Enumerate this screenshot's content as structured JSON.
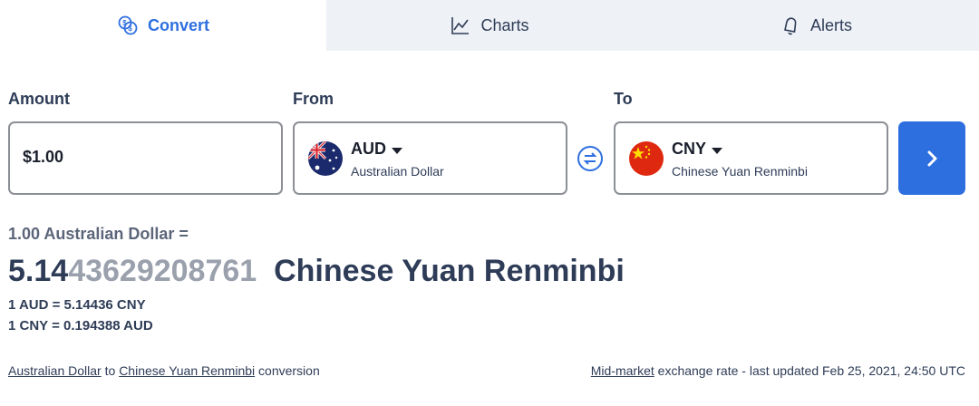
{
  "tabs": [
    {
      "label": "Convert",
      "icon": "coins-icon",
      "active": true
    },
    {
      "label": "Charts",
      "icon": "chart-line-icon",
      "active": false
    },
    {
      "label": "Alerts",
      "icon": "bell-icon",
      "active": false
    }
  ],
  "form": {
    "amount_label": "Amount",
    "amount_value": "$1.00",
    "from_label": "From",
    "to_label": "To",
    "from": {
      "code": "AUD",
      "name": "Australian Dollar",
      "flag": "australia-flag-icon"
    },
    "to": {
      "code": "CNY",
      "name": "Chinese Yuan Renminbi",
      "flag": "china-flag-icon"
    },
    "swap_icon": "swap-icon",
    "submit_icon": "chevron-right-icon"
  },
  "result": {
    "from_text": "1.00 Australian Dollar =",
    "value_main": "5.14",
    "value_rest": "43629208761",
    "to_name": "Chinese Yuan Renminbi",
    "rate_forward": "1 AUD = 5.14436 CNY",
    "rate_reverse": "1 CNY = 0.194388 AUD"
  },
  "footer": {
    "from_link": "Australian Dollar",
    "to_word": "to",
    "to_link": "Chinese Yuan Renminbi",
    "conversion_word": "conversion",
    "midmarket_link": "Mid-market",
    "updated_text": "exchange rate - last updated Feb 25, 2021, 24:50 UTC"
  },
  "colors": {
    "accent": "#2e6fe0",
    "text": "#2e3c57",
    "muted": "#9aa1ad",
    "tab_bg": "#eef1f6"
  }
}
